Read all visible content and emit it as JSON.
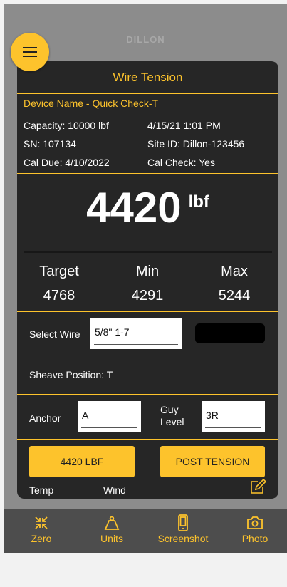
{
  "brand": "DILLON",
  "card": {
    "title": "Wire Tension",
    "device_name": "Device Name  -  Quick Check-T",
    "info": [
      {
        "left": "Capacity: 10000 lbf",
        "right": "4/15/21 1:01 PM"
      },
      {
        "left": "SN: 107134",
        "right": "Site ID: Dillon-123456"
      },
      {
        "left": "Cal Due:  4/10/2022",
        "right": "Cal Check: Yes"
      }
    ],
    "reading_value": "4420",
    "reading_unit": "lbf",
    "targets": {
      "target_label": "Target",
      "target_value": "4768",
      "min_label": "Min",
      "min_value": "4291",
      "max_label": "Max",
      "max_value": "5244"
    },
    "select_wire_label": "Select Wire",
    "select_wire_value": "5/8\" 1-7",
    "sheave_position": "Sheave Position:  T",
    "anchor_label": "Anchor",
    "anchor_value": "A",
    "guy_level_label_1": "Guy",
    "guy_level_label_2": "Level",
    "guy_level_value": "3R",
    "record_button": "4420 LBF",
    "post_tension_button": "POST TENSION",
    "temp_label": "Temp",
    "wind_label": "Wind"
  },
  "nav": [
    {
      "label": "Zero",
      "icon": "zero-icon"
    },
    {
      "label": "Units",
      "icon": "weight-icon"
    },
    {
      "label": "Screenshot",
      "icon": "phone-icon"
    },
    {
      "label": "Photo",
      "icon": "camera-icon"
    }
  ],
  "colors": {
    "accent": "#fdc32c",
    "card": "#262626",
    "nav": "#4d4d4d",
    "backdrop": "#8c8c8c"
  }
}
